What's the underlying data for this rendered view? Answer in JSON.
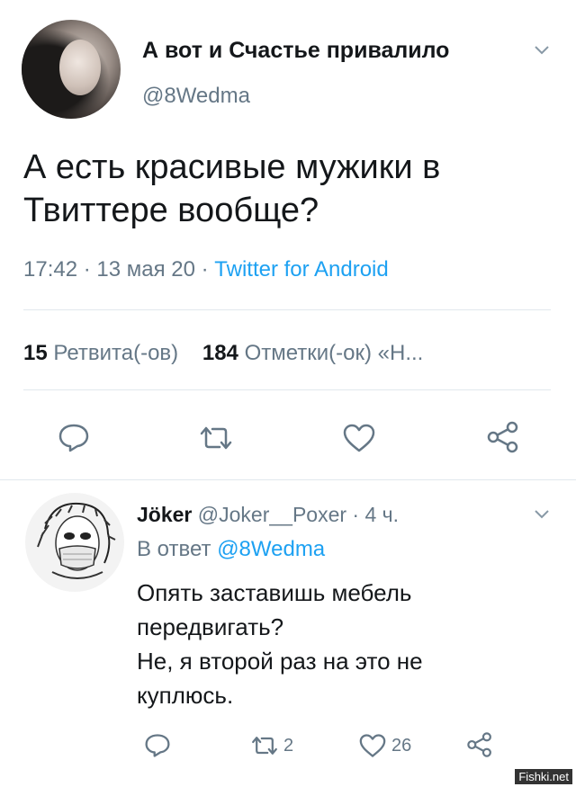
{
  "main_tweet": {
    "display_name": "А вот и Счастье привалило",
    "handle": "@8Wedma",
    "text_lines": [
      "А есть красивые мужики в",
      "Твиттере вообще?"
    ],
    "time": "17:42 · 13 мая 20 ·",
    "source": "Twitter for Android",
    "retweets_count": "15",
    "retweets_label": "Ретвита(-ов)",
    "likes_count": "184",
    "likes_label": "Отметки(-ок) «Н..."
  },
  "reply": {
    "display_name": "Jöker",
    "handle_time": "@Joker__Poxer · 4 ч.",
    "reply_to_label": "В ответ",
    "reply_to_handle": "@8Wedma",
    "text_lines": [
      "Опять заставишь мебель",
      "передвигать?",
      "Не, я второй раз на это не",
      "куплюсь."
    ],
    "retweet_count": "2",
    "like_count": "26"
  },
  "watermark": "Fishki.net",
  "icons": [
    "avatar",
    "chevron-down-icon",
    "reply-icon",
    "retweet-icon",
    "like-icon",
    "share-icon"
  ],
  "colors": {
    "text": "#14171a",
    "secondary": "#657786",
    "accent": "#1da1f2",
    "divider": "#e1e8ed"
  }
}
